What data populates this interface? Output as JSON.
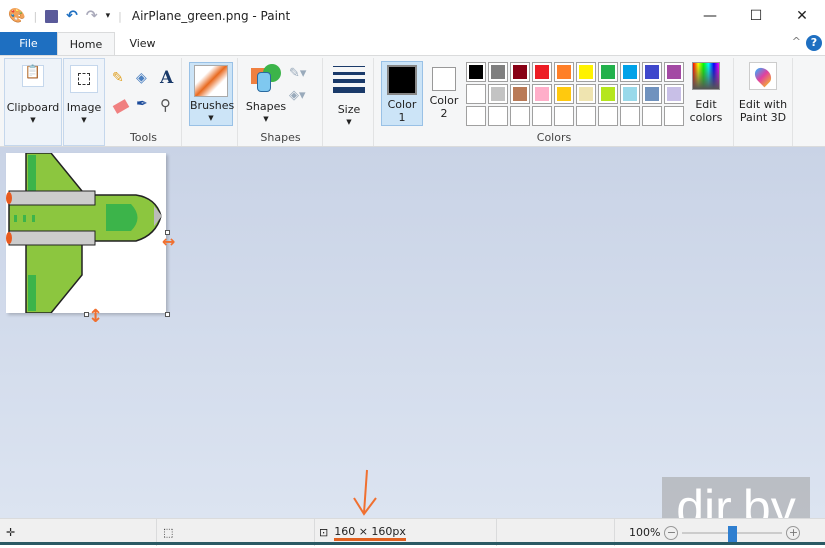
{
  "window": {
    "title": "AirPlane_green.png - Paint",
    "minimize": "—",
    "maximize": "☐",
    "close": "✕"
  },
  "tabs": [
    {
      "label": "File"
    },
    {
      "label": "Home"
    },
    {
      "label": "View"
    }
  ],
  "ribbon": {
    "clipboard": "Clipboard",
    "image": "Image",
    "tools": "Tools",
    "brushes": "Brushes",
    "shapes_btn": "Shapes",
    "shapes_group": "Shapes",
    "size": "Size",
    "color1": "Color\n1",
    "color1_a": "Color",
    "color1_b": "1",
    "color2_a": "Color",
    "color2_b": "2",
    "colors_group": "Colors",
    "edit_colors_a": "Edit",
    "edit_colors_b": "colors",
    "paint3d_a": "Edit with",
    "paint3d_b": "Paint 3D",
    "help": "?",
    "collapse": "^",
    "palette_row1": [
      "#000000",
      "#7f7f7f",
      "#880015",
      "#ed1c24",
      "#ff7f27",
      "#fff200",
      "#22b14c",
      "#00a2e8",
      "#3f48cc",
      "#a349a4"
    ],
    "palette_row2": [
      "#ffffff",
      "#c3c3c3",
      "#b97a57",
      "#ffaec9",
      "#ffc90e",
      "#efe4b0",
      "#b5e61d",
      "#99d9ea",
      "#7092be",
      "#c8bfe7"
    ]
  },
  "status": {
    "image_size": "160 × 160px",
    "zoom": "100%",
    "zoom_fraction": 0.5
  },
  "watermark": "dir.by",
  "colors": {
    "accent": "#1e6fc1",
    "annotation": "#f07030",
    "plane_green": "#8cc63f",
    "plane_dark": "#3cb44a"
  }
}
